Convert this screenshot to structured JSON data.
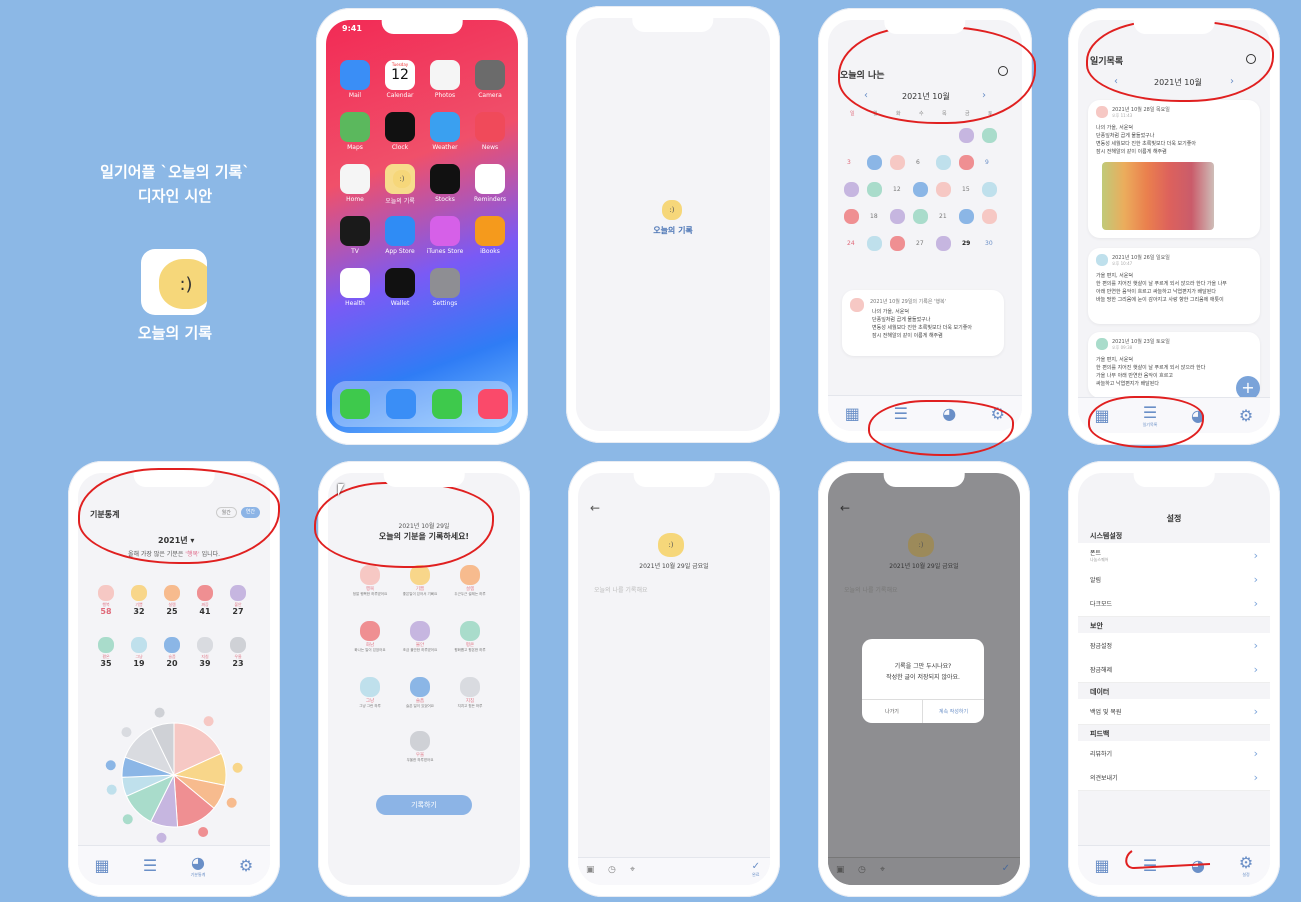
{
  "intro": {
    "title1": "일기어플 `오늘의 기록`",
    "title2": "디자인 시안",
    "app_name": "오늘의 기록"
  },
  "home": {
    "time": "9:41",
    "apps": [
      {
        "label": "Mail",
        "color": "#3a8ef6"
      },
      {
        "label": "Calendar",
        "color": "#ffffff"
      },
      {
        "label": "Photos",
        "color": "#f5f5f5"
      },
      {
        "label": "Camera",
        "color": "#6b6b6b"
      },
      {
        "label": "Maps",
        "color": "#5bb85d"
      },
      {
        "label": "Clock",
        "color": "#111111"
      },
      {
        "label": "Weather",
        "color": "#3aa0f0"
      },
      {
        "label": "News",
        "color": "#f04a5a"
      },
      {
        "label": "Home",
        "color": "#f5f5f5"
      },
      {
        "label": "오늘의 기록",
        "color": "#f7dc8c"
      },
      {
        "label": "Stocks",
        "color": "#111111"
      },
      {
        "label": "Reminders",
        "color": "#ffffff"
      },
      {
        "label": "TV",
        "color": "#1a1a1a"
      },
      {
        "label": "App Store",
        "color": "#2f8cf5"
      },
      {
        "label": "iTunes Store",
        "color": "#d660e8"
      },
      {
        "label": "iBooks",
        "color": "#f59a1c"
      },
      {
        "label": "Health",
        "color": "#ffffff"
      },
      {
        "label": "Wallet",
        "color": "#111111"
      },
      {
        "label": "Settings",
        "color": "#8e8e93"
      }
    ],
    "calendar_day": "Tuesday",
    "calendar_date": "12",
    "dock": [
      {
        "label": "Phone",
        "color": "#3ec94c"
      },
      {
        "label": "Safari",
        "color": "#3a8ef6"
      },
      {
        "label": "Messages",
        "color": "#3ec94c"
      },
      {
        "label": "Music",
        "color": "#fa4a6a"
      }
    ]
  },
  "splash": {
    "label": "오늘의 기록"
  },
  "calendar": {
    "title": "오늘의 나는",
    "month": "2021년 10월",
    "weekdays": [
      "일",
      "월",
      "화",
      "수",
      "목",
      "금",
      "토"
    ],
    "rows": [
      [
        "",
        "",
        "",
        "",
        "",
        "1",
        "2"
      ],
      [
        "3",
        "4",
        "5",
        "6",
        "7",
        "8",
        "9"
      ],
      [
        "10",
        "11",
        "12",
        "13",
        "14",
        "15",
        "16"
      ],
      [
        "17",
        "18",
        "19",
        "20",
        "21",
        "22",
        "23"
      ],
      [
        "24",
        "25",
        "26",
        "27",
        "28",
        "29",
        "30"
      ]
    ],
    "entry_date": "2021년 10월 29일의 기록은 '행복'",
    "entry_lines": [
      "나의 가을, 서윤덕",
      "단풍잎처럼 곱게 물들었구나",
      "변동성 세월보다 진한 초록빛보다 더욱 보기좋아",
      "잠시 전해알의 같이 이름게 해주렴"
    ]
  },
  "list": {
    "title": "일기목록",
    "month": "2021년 10월",
    "entries": [
      {
        "date": "2021년 10월 28일 목요일",
        "time": "오후 11:43",
        "lines": [
          "나의 가을, 서윤덕",
          "단풍잎처럼 곱게 물들었구나",
          "변동성 세월보다 진한 초록빛보다 더욱 보기좋아",
          "잠시 전해알의 같이 이름게 해주렴"
        ]
      },
      {
        "date": "2021년 10월 26일 일요일",
        "time": "오후 10:47",
        "lines": [
          "가을 편지, 서윤덕",
          "한 편의를 지어진 햇살이 날 푸르게 되서 앉으라 한다 가을 나무",
          "아래 만연한 음악이 흐르고 싸늘하고 낙엽편지가 배달된다",
          "바늘 땅한 그리움에 눈이 감아지고 사랑 향한 그리움에 애틋이"
        ]
      },
      {
        "date": "2021년 10월 23일 토요일",
        "time": "오후 09:38",
        "lines": [
          "가을 편지, 서윤덕",
          "한 편의를 지어진 햇살이 날 푸르게 되서 앉으라 한다",
          "가을 나무 아래 만연한 음악이 흐르고",
          "싸늘하고 낙엽편지가 배달된다"
        ]
      }
    ],
    "tab_label": "일기목록"
  },
  "stats": {
    "title": "기분통계",
    "toggle": [
      "월간",
      "연간"
    ],
    "year": "2021년 ▾",
    "sentence_pre": "올해 가장 많은 기분은",
    "sentence_mood": "'행복'",
    "sentence_post": "입니다.",
    "moods": [
      {
        "name": "행복",
        "count": "58",
        "color": "#f6c8c4"
      },
      {
        "name": "기쁨",
        "count": "32",
        "color": "#f8d68a"
      },
      {
        "name": "설렘",
        "count": "25",
        "color": "#f7bb8e"
      },
      {
        "name": "짜증",
        "count": "41",
        "color": "#ef8f92"
      },
      {
        "name": "불안",
        "count": "27",
        "color": "#c6b6e0"
      },
      {
        "name": "평온",
        "count": "35",
        "color": "#a9dccb"
      },
      {
        "name": "그냥",
        "count": "19",
        "color": "#bfe0ec"
      },
      {
        "name": "슬픔",
        "count": "20",
        "color": "#8bb6e6"
      },
      {
        "name": "지침",
        "count": "39",
        "color": "#d9dbe0"
      },
      {
        "name": "우울",
        "count": "23",
        "color": "#cfd1d6"
      }
    ],
    "tab_label": "기분통계"
  },
  "mood_pick": {
    "date": "2021년 10월 29일",
    "prompt": "오늘의 기분을 기록하세요!",
    "button": "기록하기",
    "moods": [
      {
        "name": "행복",
        "desc": "정말 행복한 하루였어요"
      },
      {
        "name": "기쁨",
        "desc": "좋은일이 있어서 기뻐요"
      },
      {
        "name": "설렘",
        "desc": "두근두근 설레는 하루"
      },
      {
        "name": "화남",
        "desc": "화나는 일이 있었어요"
      },
      {
        "name": "불안",
        "desc": "조금 불안한 하루였어요"
      },
      {
        "name": "평온",
        "desc": "평화롭고 평온한 하루"
      },
      {
        "name": "그냥",
        "desc": "그냥 그런 하루"
      },
      {
        "name": "슬픔",
        "desc": "슬픈 일이 있었어요"
      },
      {
        "name": "지침",
        "desc": "지치고 힘든 하루"
      },
      {
        "name": "우울",
        "desc": "우울한 하루였어요"
      }
    ]
  },
  "write": {
    "date": "2021년 10월 29일 금요일",
    "placeholder": "오늘의 나를 기록해요",
    "done": "완료"
  },
  "dialog": {
    "date": "2021년 10월 29일 금요일",
    "placeholder": "오늘의 나를 기록해요",
    "line1": "기록을 그만 두시나요?",
    "line2": "작성한 글이 저장되지 않아요.",
    "cancel": "나가기",
    "confirm": "계속 작성하기"
  },
  "settings": {
    "title": "설정",
    "sections": [
      {
        "header": "시스템설정",
        "rows": [
          {
            "label": "폰트",
            "sub": "나눔스퀘어"
          },
          {
            "label": "알림",
            "sub": ""
          },
          {
            "label": "다크모드",
            "sub": ""
          }
        ]
      },
      {
        "header": "보안",
        "rows": [
          {
            "label": "잠금설정",
            "sub": ""
          },
          {
            "label": "잠금해제",
            "sub": ""
          }
        ]
      },
      {
        "header": "데이터",
        "rows": [
          {
            "label": "백업 및 복원",
            "sub": ""
          }
        ]
      },
      {
        "header": "피드백",
        "rows": [
          {
            "label": "리뷰하기",
            "sub": ""
          },
          {
            "label": "의견보내기",
            "sub": ""
          }
        ]
      }
    ],
    "tab_label": "설정"
  },
  "colors": {
    "background": "#8cb8e6",
    "accent": "#6a8fc7",
    "annotation": "#e02020"
  }
}
